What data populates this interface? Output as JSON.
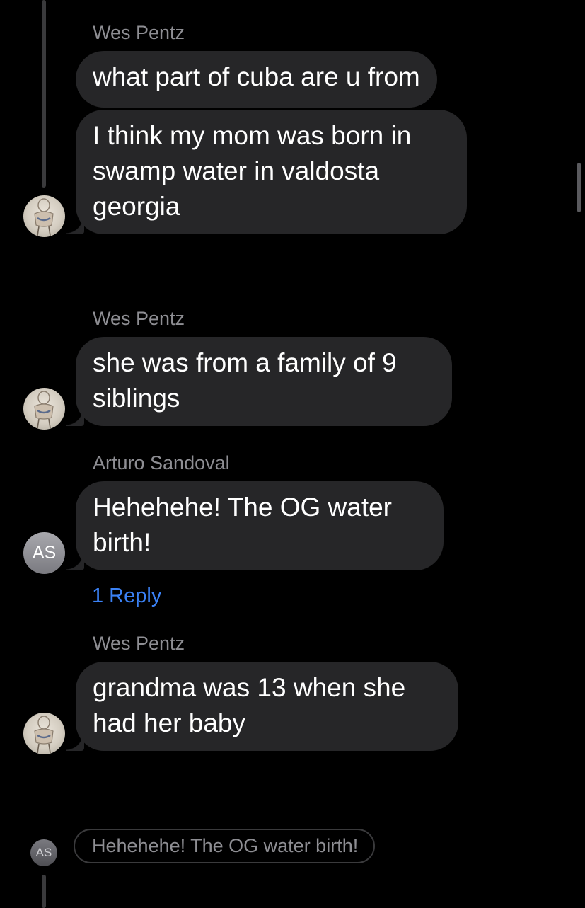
{
  "messages": [
    {
      "sender": "Wes Pentz",
      "bubbles": [
        "what part of cuba are u from",
        "I think my mom was born in swamp water in valdosta georgia"
      ]
    },
    {
      "sender": "Wes Pentz",
      "bubbles": [
        "she was from a family of 9 siblings"
      ]
    },
    {
      "sender": "Arturo Sandoval",
      "avatar_initials": "AS",
      "bubbles": [
        "Hehehehe! The OG water birth!"
      ],
      "reply_count_label": "1 Reply"
    },
    {
      "sender": "Wes Pentz",
      "bubbles": [
        "grandma was 13 when she had her baby"
      ]
    }
  ],
  "quoted_reply": {
    "avatar_initials": "AS",
    "text": "Hehehehe! The OG water birth!"
  },
  "colors": {
    "background": "#000000",
    "bubble": "#262628",
    "sender_text": "#8e8e93",
    "reply_link": "#3b82f6"
  },
  "icons": {
    "wes_avatar": "portrait-sketch-avatar",
    "arturo_avatar": "initials-avatar"
  }
}
